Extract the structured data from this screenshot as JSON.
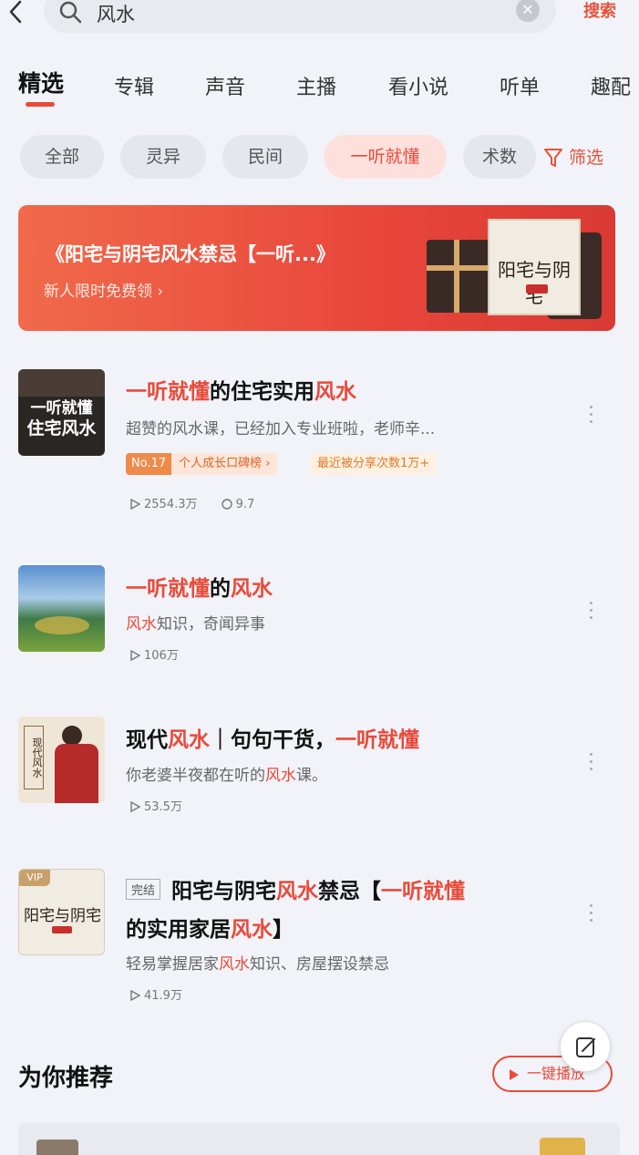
{
  "search": {
    "query": "风水",
    "action_label": "搜索"
  },
  "tabs": [
    {
      "label": "精选",
      "active": true
    },
    {
      "label": "专辑"
    },
    {
      "label": "声音"
    },
    {
      "label": "主播"
    },
    {
      "label": "看小说"
    },
    {
      "label": "听单"
    },
    {
      "label": "趣配"
    }
  ],
  "chips": [
    {
      "label": "全部"
    },
    {
      "label": "灵异"
    },
    {
      "label": "民间"
    },
    {
      "label": "一听就懂",
      "selected": true
    },
    {
      "label": "术数"
    }
  ],
  "filter_label": "筛选",
  "banner": {
    "title": "《阳宅与阴宅风水禁忌【一听...》",
    "subtitle": "新人限时免费领 ›",
    "cover_text": "阳宅与阴宅"
  },
  "results": [
    {
      "title_parts": [
        "一听就",
        "懂",
        "的住宅实用",
        "风水"
      ],
      "desc": "超赞的风水课，已经加入专业班啦，老师辛...",
      "cover_lines": [
        "一听就懂",
        "住宅风水"
      ],
      "rank_no": "No.17",
      "rank_text": "个人成长口碑榜 ›",
      "hot_text": "最近被分享次数1万+",
      "plays": "2554.3万",
      "comments": "9.7"
    },
    {
      "title_parts": [
        "一听就",
        "懂",
        "的",
        "风水"
      ],
      "desc_parts": [
        "风水",
        "知识，奇闻异事"
      ],
      "plays": "106万"
    },
    {
      "title_parts": [
        "现代",
        "风水",
        "｜句句干货，",
        "一听就懂"
      ],
      "desc_parts": [
        "你老婆半夜都在听的",
        "风水",
        "课。"
      ],
      "cover_text": "现代风水",
      "plays": "53.5万"
    },
    {
      "badge": "完结",
      "title_line1_parts": [
        "阳宅与阴宅",
        "风水",
        "禁忌【",
        "一听就懂"
      ],
      "title_line2_parts": [
        "的实用家居",
        "风水",
        "】"
      ],
      "desc_parts": [
        "轻易掌握居家",
        "风水",
        "知识、房屋摆设禁忌"
      ],
      "cover_text": "阳宅与阴宅",
      "vip": "VIP",
      "plays": "41.9万"
    }
  ],
  "recommend": {
    "title": "为你推荐",
    "play_all": "一键播放"
  },
  "colors": {
    "accent": "#e94a3a",
    "background": "#f2f3f8"
  }
}
